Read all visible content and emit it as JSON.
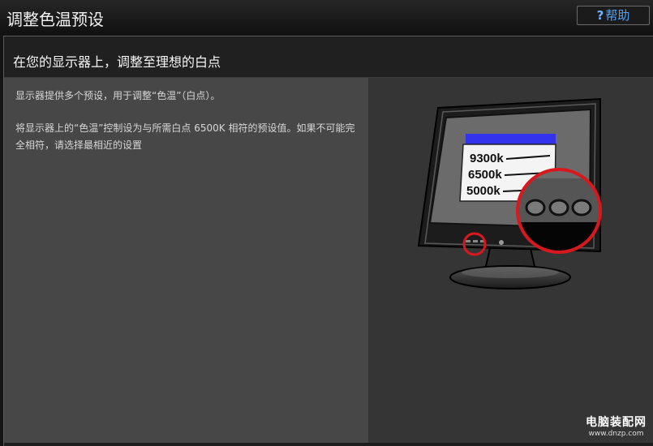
{
  "window": {
    "title": "调整色温预设"
  },
  "help": {
    "icon": "question-icon",
    "label": "帮助"
  },
  "heading": "在您的显示器上，调整至理想的白点",
  "body": {
    "paragraph1": "显示器提供多个预设，用于调整“色温”（白点）。",
    "paragraph2": "将显示器上的“色温”控制设为与所需白点 6500K 相符的预设值。如果不可能完全相符，请选择最相近的设置"
  },
  "illustration": {
    "menu_items": [
      "9300k",
      "6500k",
      "5000k"
    ],
    "accent_color": "#d7191d",
    "menu_header_color": "#3333ee"
  },
  "watermark": {
    "name": "电脑装配网",
    "url": "www.dnzp.com"
  }
}
